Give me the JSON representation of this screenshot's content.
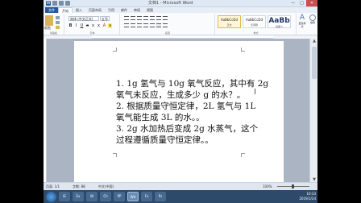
{
  "window": {
    "title": "文档1 - Microsoft Word",
    "controls": [
      "—",
      "□",
      "✕"
    ]
  },
  "tabs": [
    "文件",
    "开始",
    "插入",
    "页面布局",
    "引用",
    "邮件",
    "审阅",
    "视图"
  ],
  "ribbon": {
    "paste_label": "粘贴",
    "clipboard_label": "剪贴板",
    "font_name": "宋体 (中文正文)",
    "font_size": "五号",
    "font_group_label": "字体",
    "paragraph_group_label": "段落",
    "styles_group_label": "样式",
    "styles": [
      {
        "sample": "AaBbCcDd",
        "name": "正文"
      },
      {
        "sample": "AaBbCcDd",
        "name": "无间隔"
      },
      {
        "sample": "AaBb",
        "name": "标题 1"
      }
    ],
    "change_styles_label": "更改样式",
    "edit_label": "编辑"
  },
  "document": {
    "lines": [
      "1. 1g 氢气与 10g 氧气反应，其中有 2g",
      "氧气未反应，生成多少 g 的水？。",
      "2.  根据质量守恒定律，2L 氢气与 1L",
      "氧气能生成 3L 的水。。",
      "3.  2g 水加热后变成 2g 水蒸气，这个",
      "过程遵循质量守恒定律。。"
    ]
  },
  "statusbar": {
    "page": "页面: 1/1",
    "words": "字数: 88",
    "language": "中文(中国)",
    "zoom": "100%"
  },
  "taskbar": {
    "items": [
      "IE",
      "Ex",
      "W",
      "Ch",
      "PP",
      "Wd",
      "Fx",
      "Ps"
    ],
    "time": "10:33",
    "date": "2019/1/24"
  }
}
